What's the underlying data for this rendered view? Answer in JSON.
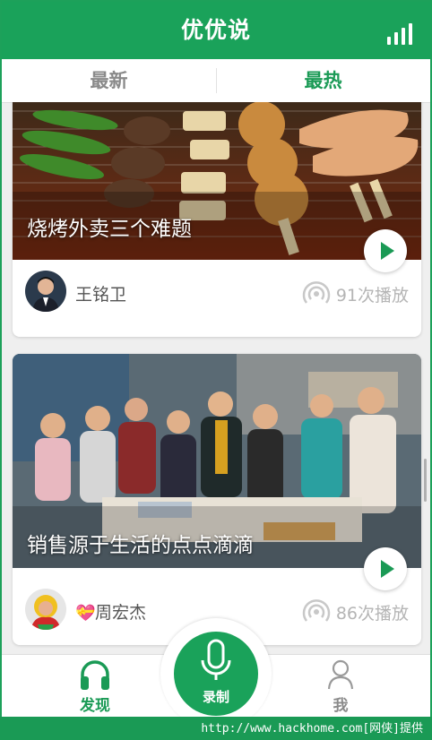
{
  "header": {
    "title": "优优说",
    "stats_icon": "stats-bars-icon"
  },
  "tabs": [
    {
      "label": "最新",
      "active": false
    },
    {
      "label": "最热",
      "active": true
    }
  ],
  "posts": [
    {
      "title": "烧烤外卖三个难题",
      "author": "王铭卫",
      "plays": "91次播放"
    },
    {
      "title": "销售源于生活的点点滴滴",
      "author": "周宏杰",
      "author_badge": "💝",
      "plays": "86次播放"
    }
  ],
  "bottom_nav": {
    "discover": "发现",
    "record": "录制",
    "me": "我"
  },
  "footer": {
    "text": "http://www.hackhome.com[网侠]提供"
  },
  "colors": {
    "brand_green": "#1aa25a",
    "muted_text": "#8a8a8a"
  }
}
